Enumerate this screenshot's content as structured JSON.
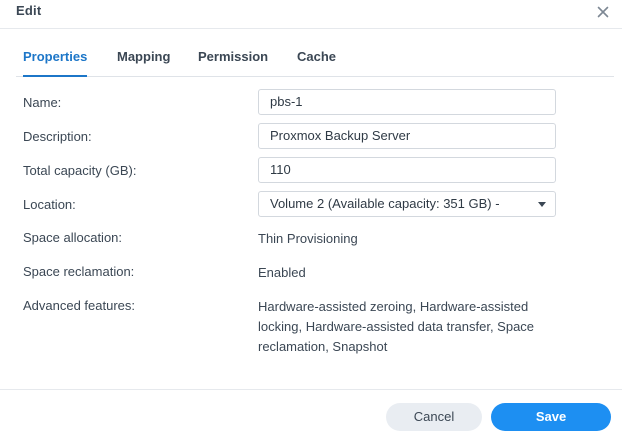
{
  "dialog": {
    "title": "Edit",
    "close_icon": "close-icon"
  },
  "tabs": [
    {
      "label": "Properties",
      "active": true
    },
    {
      "label": "Mapping",
      "active": false
    },
    {
      "label": "Permission",
      "active": false
    },
    {
      "label": "Cache",
      "active": false
    }
  ],
  "form": {
    "name": {
      "label": "Name:",
      "value": "pbs-1"
    },
    "description": {
      "label": "Description:",
      "value": "Proxmox Backup Server"
    },
    "capacity": {
      "label": "Total capacity (GB):",
      "value": "110"
    },
    "location": {
      "label": "Location:",
      "value": "Volume 2 (Available capacity: 351 GB) -"
    },
    "space_allocation": {
      "label": "Space allocation:",
      "value": "Thin Provisioning"
    },
    "space_reclamation": {
      "label": "Space reclamation:",
      "value": "Enabled"
    },
    "advanced_features": {
      "label": "Advanced features:",
      "lines": [
        "Hardware-assisted zeroing, Hardware-assisted",
        "locking, Hardware-assisted data transfer, Space",
        "reclamation, Snapshot"
      ]
    }
  },
  "footer": {
    "cancel_label": "Cancel",
    "save_label": "Save"
  },
  "colors": {
    "accent": "#1c76c8",
    "primary_button": "#1d8ff2",
    "secondary_button": "#e9edf2"
  }
}
